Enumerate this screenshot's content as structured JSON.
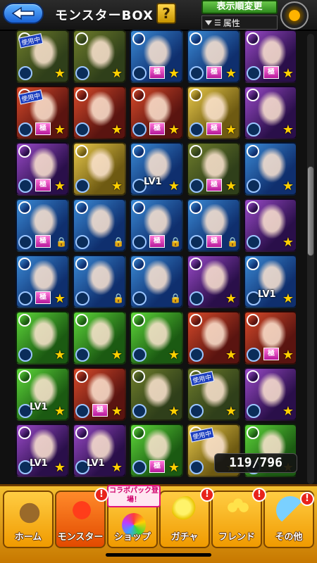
{
  "header": {
    "title": "モンスターBOX",
    "help_label": "?",
    "sort_label": "表示順変更",
    "filter_label": "属性",
    "back_icon": "back-arrow-icon",
    "gear_icon": "settings-icon"
  },
  "box": {
    "count": "119/796",
    "tiles": [
      {
        "cls": "wood",
        "inuse": "使用中",
        "goku": "",
        "lv": "",
        "lock": false
      },
      {
        "cls": "wood",
        "inuse": "",
        "goku": "",
        "lv": "",
        "lock": false
      },
      {
        "cls": "water",
        "inuse": "",
        "goku": "極",
        "lv": "",
        "lock": false
      },
      {
        "cls": "water",
        "inuse": "",
        "goku": "極",
        "lv": "",
        "lock": false
      },
      {
        "cls": "dark",
        "inuse": "",
        "goku": "極",
        "lv": "",
        "lock": false
      },
      {
        "cls": "fire",
        "inuse": "使用中",
        "goku": "極",
        "lv": "",
        "lock": false
      },
      {
        "cls": "fire",
        "inuse": "",
        "goku": "",
        "lv": "",
        "lock": false
      },
      {
        "cls": "fire",
        "inuse": "",
        "goku": "極",
        "lv": "",
        "lock": false
      },
      {
        "cls": "light",
        "inuse": "",
        "goku": "極",
        "lv": "",
        "lock": false
      },
      {
        "cls": "dark",
        "inuse": "",
        "goku": "",
        "lv": "",
        "lock": false
      },
      {
        "cls": "dark",
        "inuse": "",
        "goku": "極",
        "lv": "",
        "lock": false
      },
      {
        "cls": "light",
        "inuse": "",
        "goku": "",
        "lv": "",
        "lock": false
      },
      {
        "cls": "water",
        "inuse": "",
        "goku": "",
        "lv": "LV1",
        "lock": false
      },
      {
        "cls": "wood",
        "inuse": "",
        "goku": "極",
        "lv": "",
        "lock": false
      },
      {
        "cls": "water",
        "inuse": "",
        "goku": "",
        "lv": "",
        "lock": false
      },
      {
        "cls": "water",
        "inuse": "",
        "goku": "極",
        "lv": "",
        "lock": true
      },
      {
        "cls": "water",
        "inuse": "",
        "goku": "",
        "lv": "",
        "lock": true
      },
      {
        "cls": "water",
        "inuse": "",
        "goku": "極",
        "lv": "",
        "lock": true
      },
      {
        "cls": "water",
        "inuse": "",
        "goku": "極",
        "lv": "",
        "lock": true
      },
      {
        "cls": "dark",
        "inuse": "",
        "goku": "",
        "lv": "",
        "lock": false
      },
      {
        "cls": "water",
        "inuse": "",
        "goku": "極",
        "lv": "",
        "lock": false
      },
      {
        "cls": "water",
        "inuse": "",
        "goku": "",
        "lv": "",
        "lock": true
      },
      {
        "cls": "water",
        "inuse": "",
        "goku": "",
        "lv": "",
        "lock": true
      },
      {
        "cls": "dark",
        "inuse": "",
        "goku": "",
        "lv": "",
        "lock": false
      },
      {
        "cls": "water",
        "inuse": "",
        "goku": "",
        "lv": "LV1",
        "lock": false
      },
      {
        "cls": "green",
        "inuse": "",
        "goku": "",
        "lv": "",
        "lock": false
      },
      {
        "cls": "green",
        "inuse": "",
        "goku": "",
        "lv": "",
        "lock": false
      },
      {
        "cls": "green",
        "inuse": "",
        "goku": "",
        "lv": "",
        "lock": false
      },
      {
        "cls": "fire",
        "inuse": "",
        "goku": "",
        "lv": "",
        "lock": false
      },
      {
        "cls": "fire",
        "inuse": "",
        "goku": "極",
        "lv": "",
        "lock": false
      },
      {
        "cls": "green",
        "inuse": "",
        "goku": "",
        "lv": "LV1",
        "lock": false
      },
      {
        "cls": "fire",
        "inuse": "",
        "goku": "極",
        "lv": "",
        "lock": false
      },
      {
        "cls": "wood",
        "inuse": "",
        "goku": "",
        "lv": "",
        "lock": false
      },
      {
        "cls": "wood",
        "inuse": "使用中",
        "goku": "",
        "lv": "",
        "lock": false
      },
      {
        "cls": "dark",
        "inuse": "",
        "goku": "",
        "lv": "",
        "lock": false
      },
      {
        "cls": "dark",
        "inuse": "",
        "goku": "",
        "lv": "LV1",
        "lock": false
      },
      {
        "cls": "dark",
        "inuse": "",
        "goku": "",
        "lv": "LV1",
        "lock": false
      },
      {
        "cls": "green",
        "inuse": "",
        "goku": "極",
        "lv": "",
        "lock": false
      },
      {
        "cls": "light",
        "inuse": "使用中",
        "goku": "",
        "lv": "",
        "lock": false
      },
      {
        "cls": "green",
        "inuse": "",
        "goku": "",
        "lv": "",
        "lock": false
      }
    ]
  },
  "nav": {
    "home": "ホーム",
    "monster": "モンスター",
    "shop": "ショップ",
    "gacha": "ガチャ",
    "friend": "フレンド",
    "other": "その他",
    "collab_banner": "コラボパック登場！",
    "badge": "!"
  },
  "colors": {
    "nav_bg": "#f0a800",
    "back_blue": "#2b7be8",
    "sort_green": "#3da12a"
  }
}
